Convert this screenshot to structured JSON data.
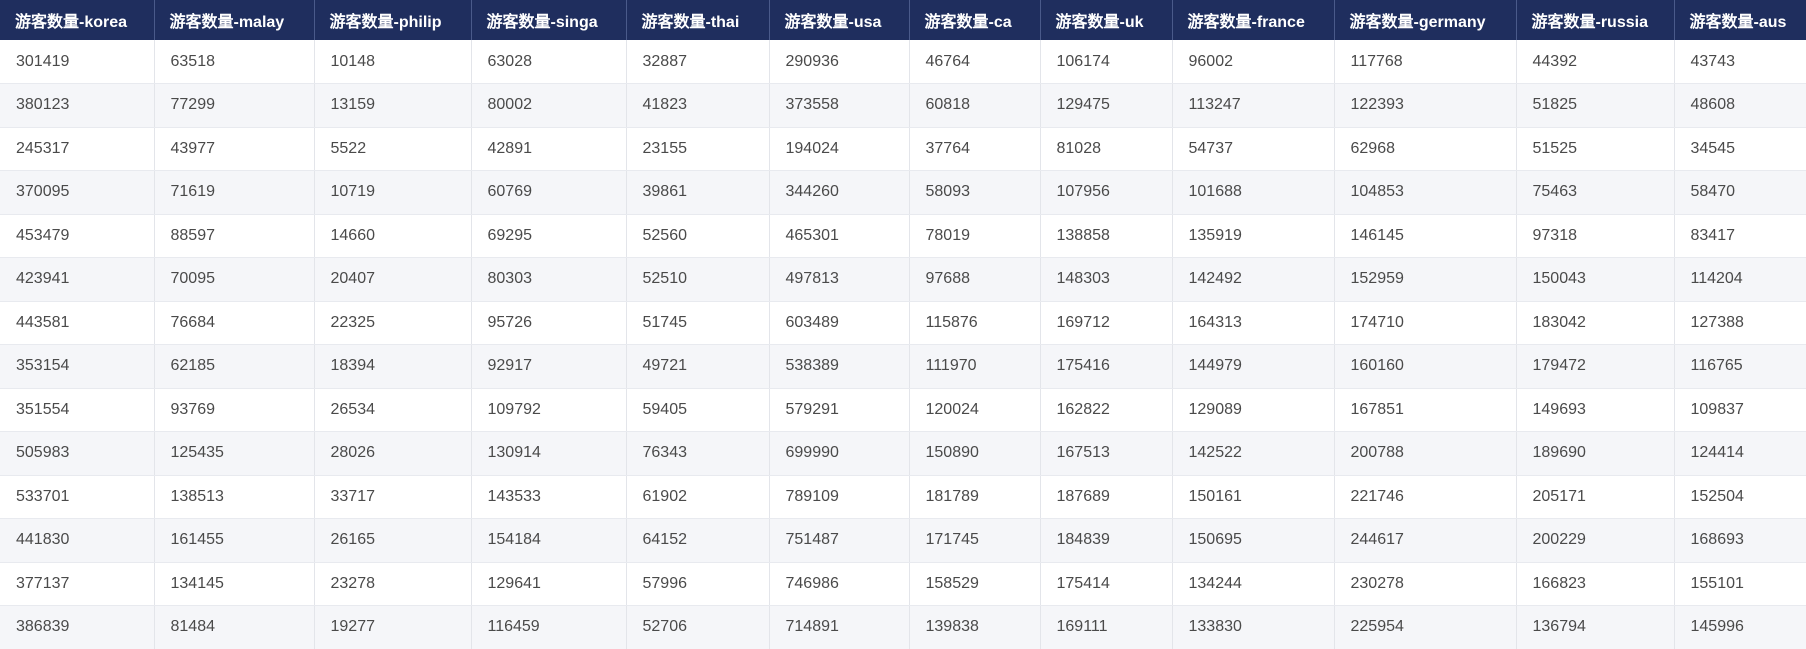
{
  "table": {
    "columns": [
      "游客数量-korea",
      "游客数量-malay",
      "游客数量-philip",
      "游客数量-singa",
      "游客数量-thai",
      "游客数量-usa",
      "游客数量-ca",
      "游客数量-uk",
      "游客数量-france",
      "游客数量-germany",
      "游客数量-russia",
      "游客数量-aus"
    ],
    "rows": [
      [
        "301419",
        "63518",
        "10148",
        "63028",
        "32887",
        "290936",
        "46764",
        "106174",
        "96002",
        "117768",
        "44392",
        "43743"
      ],
      [
        "380123",
        "77299",
        "13159",
        "80002",
        "41823",
        "373558",
        "60818",
        "129475",
        "113247",
        "122393",
        "51825",
        "48608"
      ],
      [
        "245317",
        "43977",
        "5522",
        "42891",
        "23155",
        "194024",
        "37764",
        "81028",
        "54737",
        "62968",
        "51525",
        "34545"
      ],
      [
        "370095",
        "71619",
        "10719",
        "60769",
        "39861",
        "344260",
        "58093",
        "107956",
        "101688",
        "104853",
        "75463",
        "58470"
      ],
      [
        "453479",
        "88597",
        "14660",
        "69295",
        "52560",
        "465301",
        "78019",
        "138858",
        "135919",
        "146145",
        "97318",
        "83417"
      ],
      [
        "423941",
        "70095",
        "20407",
        "80303",
        "52510",
        "497813",
        "97688",
        "148303",
        "142492",
        "152959",
        "150043",
        "114204"
      ],
      [
        "443581",
        "76684",
        "22325",
        "95726",
        "51745",
        "603489",
        "115876",
        "169712",
        "164313",
        "174710",
        "183042",
        "127388"
      ],
      [
        "353154",
        "62185",
        "18394",
        "92917",
        "49721",
        "538389",
        "111970",
        "175416",
        "144979",
        "160160",
        "179472",
        "116765"
      ],
      [
        "351554",
        "93769",
        "26534",
        "109792",
        "59405",
        "579291",
        "120024",
        "162822",
        "129089",
        "167851",
        "149693",
        "109837"
      ],
      [
        "505983",
        "125435",
        "28026",
        "130914",
        "76343",
        "699990",
        "150890",
        "167513",
        "142522",
        "200788",
        "189690",
        "124414"
      ],
      [
        "533701",
        "138513",
        "33717",
        "143533",
        "61902",
        "789109",
        "181789",
        "187689",
        "150161",
        "221746",
        "205171",
        "152504"
      ],
      [
        "441830",
        "161455",
        "26165",
        "154184",
        "64152",
        "751487",
        "171745",
        "184839",
        "150695",
        "244617",
        "200229",
        "168693"
      ],
      [
        "377137",
        "134145",
        "23278",
        "129641",
        "57996",
        "746986",
        "158529",
        "175414",
        "134244",
        "230278",
        "166823",
        "155101"
      ],
      [
        "386839",
        "81484",
        "19277",
        "116459",
        "52706",
        "714891",
        "139838",
        "169111",
        "133830",
        "225954",
        "136794",
        "145996"
      ]
    ]
  },
  "colors": {
    "header_bg": "#1f2e5e",
    "header_text": "#ffffff",
    "row_alt_bg": "#f5f6f9",
    "cell_text": "#4a4a4a"
  }
}
